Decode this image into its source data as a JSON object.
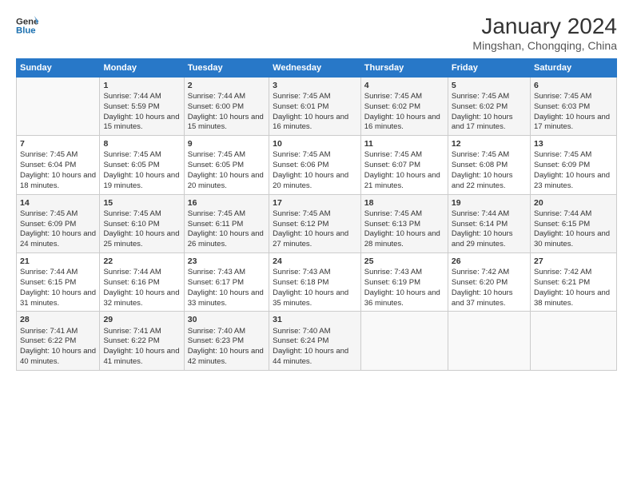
{
  "header": {
    "logo_line1": "General",
    "logo_line2": "Blue",
    "title": "January 2024",
    "subtitle": "Mingshan, Chongqing, China"
  },
  "days_of_week": [
    "Sunday",
    "Monday",
    "Tuesday",
    "Wednesday",
    "Thursday",
    "Friday",
    "Saturday"
  ],
  "weeks": [
    [
      {
        "day": "",
        "sunrise": "",
        "sunset": "",
        "daylight": ""
      },
      {
        "day": "1",
        "sunrise": "Sunrise: 7:44 AM",
        "sunset": "Sunset: 5:59 PM",
        "daylight": "Daylight: 10 hours and 15 minutes."
      },
      {
        "day": "2",
        "sunrise": "Sunrise: 7:44 AM",
        "sunset": "Sunset: 6:00 PM",
        "daylight": "Daylight: 10 hours and 15 minutes."
      },
      {
        "day": "3",
        "sunrise": "Sunrise: 7:45 AM",
        "sunset": "Sunset: 6:01 PM",
        "daylight": "Daylight: 10 hours and 16 minutes."
      },
      {
        "day": "4",
        "sunrise": "Sunrise: 7:45 AM",
        "sunset": "Sunset: 6:02 PM",
        "daylight": "Daylight: 10 hours and 16 minutes."
      },
      {
        "day": "5",
        "sunrise": "Sunrise: 7:45 AM",
        "sunset": "Sunset: 6:02 PM",
        "daylight": "Daylight: 10 hours and 17 minutes."
      },
      {
        "day": "6",
        "sunrise": "Sunrise: 7:45 AM",
        "sunset": "Sunset: 6:03 PM",
        "daylight": "Daylight: 10 hours and 17 minutes."
      }
    ],
    [
      {
        "day": "7",
        "sunrise": "Sunrise: 7:45 AM",
        "sunset": "Sunset: 6:04 PM",
        "daylight": "Daylight: 10 hours and 18 minutes."
      },
      {
        "day": "8",
        "sunrise": "Sunrise: 7:45 AM",
        "sunset": "Sunset: 6:05 PM",
        "daylight": "Daylight: 10 hours and 19 minutes."
      },
      {
        "day": "9",
        "sunrise": "Sunrise: 7:45 AM",
        "sunset": "Sunset: 6:05 PM",
        "daylight": "Daylight: 10 hours and 20 minutes."
      },
      {
        "day": "10",
        "sunrise": "Sunrise: 7:45 AM",
        "sunset": "Sunset: 6:06 PM",
        "daylight": "Daylight: 10 hours and 20 minutes."
      },
      {
        "day": "11",
        "sunrise": "Sunrise: 7:45 AM",
        "sunset": "Sunset: 6:07 PM",
        "daylight": "Daylight: 10 hours and 21 minutes."
      },
      {
        "day": "12",
        "sunrise": "Sunrise: 7:45 AM",
        "sunset": "Sunset: 6:08 PM",
        "daylight": "Daylight: 10 hours and 22 minutes."
      },
      {
        "day": "13",
        "sunrise": "Sunrise: 7:45 AM",
        "sunset": "Sunset: 6:09 PM",
        "daylight": "Daylight: 10 hours and 23 minutes."
      }
    ],
    [
      {
        "day": "14",
        "sunrise": "Sunrise: 7:45 AM",
        "sunset": "Sunset: 6:09 PM",
        "daylight": "Daylight: 10 hours and 24 minutes."
      },
      {
        "day": "15",
        "sunrise": "Sunrise: 7:45 AM",
        "sunset": "Sunset: 6:10 PM",
        "daylight": "Daylight: 10 hours and 25 minutes."
      },
      {
        "day": "16",
        "sunrise": "Sunrise: 7:45 AM",
        "sunset": "Sunset: 6:11 PM",
        "daylight": "Daylight: 10 hours and 26 minutes."
      },
      {
        "day": "17",
        "sunrise": "Sunrise: 7:45 AM",
        "sunset": "Sunset: 6:12 PM",
        "daylight": "Daylight: 10 hours and 27 minutes."
      },
      {
        "day": "18",
        "sunrise": "Sunrise: 7:45 AM",
        "sunset": "Sunset: 6:13 PM",
        "daylight": "Daylight: 10 hours and 28 minutes."
      },
      {
        "day": "19",
        "sunrise": "Sunrise: 7:44 AM",
        "sunset": "Sunset: 6:14 PM",
        "daylight": "Daylight: 10 hours and 29 minutes."
      },
      {
        "day": "20",
        "sunrise": "Sunrise: 7:44 AM",
        "sunset": "Sunset: 6:15 PM",
        "daylight": "Daylight: 10 hours and 30 minutes."
      }
    ],
    [
      {
        "day": "21",
        "sunrise": "Sunrise: 7:44 AM",
        "sunset": "Sunset: 6:15 PM",
        "daylight": "Daylight: 10 hours and 31 minutes."
      },
      {
        "day": "22",
        "sunrise": "Sunrise: 7:44 AM",
        "sunset": "Sunset: 6:16 PM",
        "daylight": "Daylight: 10 hours and 32 minutes."
      },
      {
        "day": "23",
        "sunrise": "Sunrise: 7:43 AM",
        "sunset": "Sunset: 6:17 PM",
        "daylight": "Daylight: 10 hours and 33 minutes."
      },
      {
        "day": "24",
        "sunrise": "Sunrise: 7:43 AM",
        "sunset": "Sunset: 6:18 PM",
        "daylight": "Daylight: 10 hours and 35 minutes."
      },
      {
        "day": "25",
        "sunrise": "Sunrise: 7:43 AM",
        "sunset": "Sunset: 6:19 PM",
        "daylight": "Daylight: 10 hours and 36 minutes."
      },
      {
        "day": "26",
        "sunrise": "Sunrise: 7:42 AM",
        "sunset": "Sunset: 6:20 PM",
        "daylight": "Daylight: 10 hours and 37 minutes."
      },
      {
        "day": "27",
        "sunrise": "Sunrise: 7:42 AM",
        "sunset": "Sunset: 6:21 PM",
        "daylight": "Daylight: 10 hours and 38 minutes."
      }
    ],
    [
      {
        "day": "28",
        "sunrise": "Sunrise: 7:41 AM",
        "sunset": "Sunset: 6:22 PM",
        "daylight": "Daylight: 10 hours and 40 minutes."
      },
      {
        "day": "29",
        "sunrise": "Sunrise: 7:41 AM",
        "sunset": "Sunset: 6:22 PM",
        "daylight": "Daylight: 10 hours and 41 minutes."
      },
      {
        "day": "30",
        "sunrise": "Sunrise: 7:40 AM",
        "sunset": "Sunset: 6:23 PM",
        "daylight": "Daylight: 10 hours and 42 minutes."
      },
      {
        "day": "31",
        "sunrise": "Sunrise: 7:40 AM",
        "sunset": "Sunset: 6:24 PM",
        "daylight": "Daylight: 10 hours and 44 minutes."
      },
      {
        "day": "",
        "sunrise": "",
        "sunset": "",
        "daylight": ""
      },
      {
        "day": "",
        "sunrise": "",
        "sunset": "",
        "daylight": ""
      },
      {
        "day": "",
        "sunrise": "",
        "sunset": "",
        "daylight": ""
      }
    ]
  ]
}
